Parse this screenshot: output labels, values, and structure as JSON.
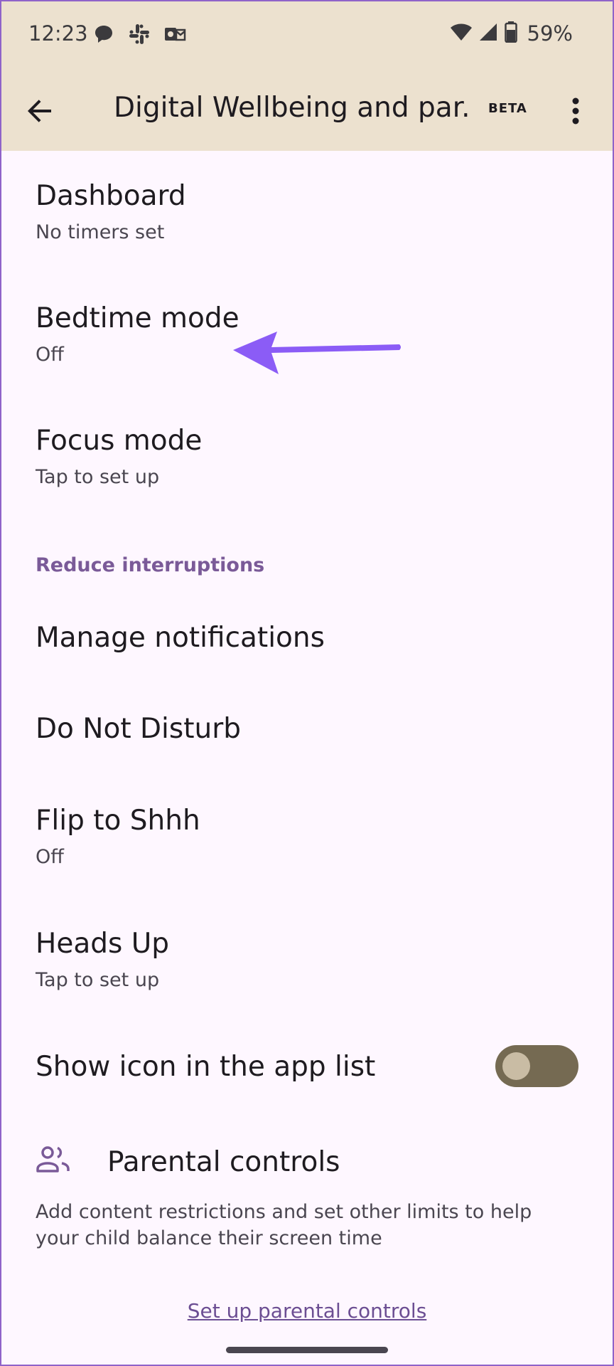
{
  "status_bar": {
    "time": "12:23",
    "battery_percent": "59%",
    "notification_icons": [
      "messages-icon",
      "slack-icon",
      "outlook-icon"
    ],
    "system_icons": [
      "wifi-icon",
      "cell-signal-icon",
      "battery-icon"
    ]
  },
  "app_bar": {
    "title": "Digital Wellbeing and par...",
    "badge": "BETA",
    "back_icon": "arrow-back-icon",
    "more_icon": "more-vert-icon"
  },
  "items": [
    {
      "title": "Dashboard",
      "subtitle": "No timers set"
    },
    {
      "title": "Bedtime mode",
      "subtitle": "Off"
    },
    {
      "title": "Focus mode",
      "subtitle": "Tap to set up"
    }
  ],
  "section": {
    "header": "Reduce interruptions"
  },
  "interruptions": [
    {
      "title": "Manage notifications"
    },
    {
      "title": "Do Not Disturb"
    },
    {
      "title": "Flip to Shhh",
      "subtitle": "Off"
    },
    {
      "title": "Heads Up",
      "subtitle": "Tap to set up"
    }
  ],
  "show_icon": {
    "title": "Show icon in the app list",
    "enabled": false
  },
  "parental": {
    "title": "Parental controls",
    "description": "Add content restrictions and set other limits to help your child balance their screen time",
    "link": "Set up parental controls",
    "icon": "people-icon"
  },
  "colors": {
    "top_bar": "#ece1cf",
    "background": "#fef7ff",
    "accent": "#7a5a98",
    "annotation_arrow": "#8b5cf6",
    "toggle_track": "#756a52"
  }
}
